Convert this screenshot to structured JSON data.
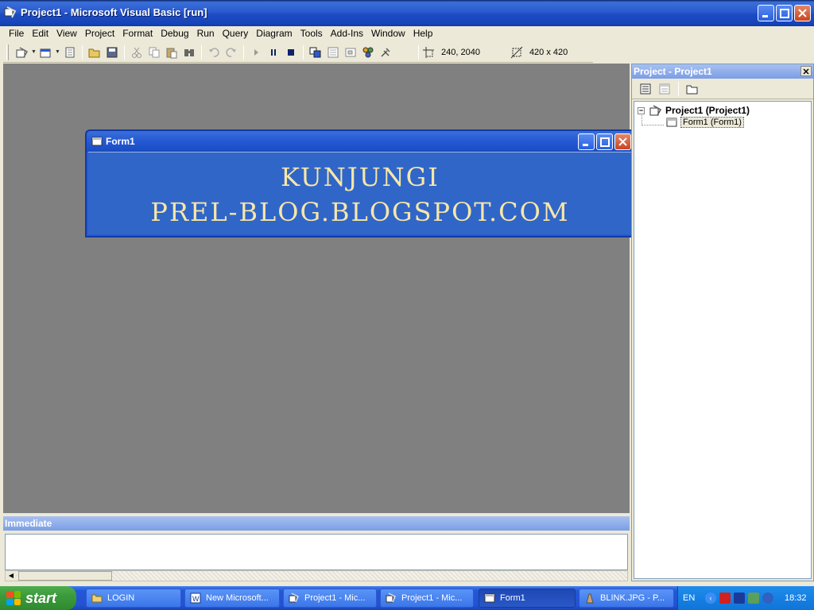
{
  "window": {
    "title": "Project1 - Microsoft Visual Basic [run]"
  },
  "menu": [
    {
      "label": "File"
    },
    {
      "label": "Edit"
    },
    {
      "label": "View"
    },
    {
      "label": "Project"
    },
    {
      "label": "Format"
    },
    {
      "label": "Debug"
    },
    {
      "label": "Run"
    },
    {
      "label": "Query"
    },
    {
      "label": "Diagram"
    },
    {
      "label": "Tools"
    },
    {
      "label": "Add-Ins"
    },
    {
      "label": "Window"
    },
    {
      "label": "Help"
    }
  ],
  "toolbar": {
    "position": "240, 2040",
    "size": "420 x 420"
  },
  "form1": {
    "title": "Form1",
    "line1": "KUNJUNGI",
    "line2": "PREL-BLOG.BLOGSPOT.COM",
    "text_color": "#f7e7a6",
    "bg_color": "#3166c9"
  },
  "project_panel": {
    "title": "Project - Project1",
    "root": "Project1 (Project1)",
    "child": "Form1 (Form1)"
  },
  "immediate": {
    "title": "Immediate"
  },
  "taskbar": {
    "start": "start",
    "tasks": [
      {
        "label": "LOGIN"
      },
      {
        "label": "New Microsoft..."
      },
      {
        "label": "Project1 - Mic..."
      },
      {
        "label": "Project1 - Mic..."
      },
      {
        "label": "Form1"
      },
      {
        "label": "BLINK.JPG - P..."
      }
    ],
    "lang": "EN",
    "clock": "18:32"
  }
}
